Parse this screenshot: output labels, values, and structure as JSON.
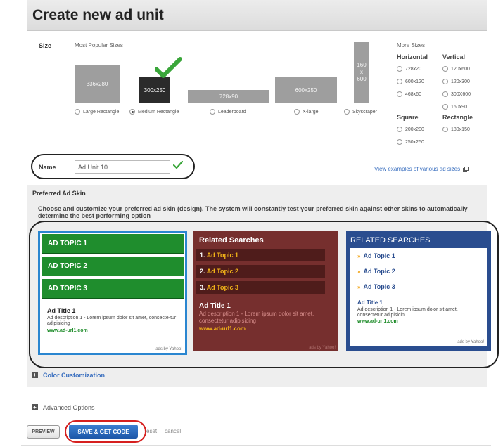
{
  "header": {
    "title": "Create new ad unit"
  },
  "size": {
    "label": "Size",
    "popular_label": "Most Popular Sizes",
    "boxes": [
      {
        "size": "336x280",
        "radio": "Large Rectangle",
        "selected": false
      },
      {
        "size": "300x250",
        "radio": "Medium Rectangle",
        "selected": true
      },
      {
        "size": "728x90",
        "radio": "Leaderboard",
        "selected": false
      },
      {
        "size": "600x250",
        "radio": "X-large",
        "selected": false
      },
      {
        "size_lines": [
          "160",
          "x",
          "600"
        ],
        "radio": "Skyscraper",
        "selected": false
      }
    ],
    "more_sizes": {
      "title": "More Sizes",
      "horizontal": {
        "title": "Horizontal",
        "options": [
          "728x20",
          "600x120",
          "468x60"
        ]
      },
      "vertical": {
        "title": "Vertical",
        "options": [
          "120x600",
          "120x300",
          "300X600",
          "160x90"
        ]
      },
      "square": {
        "title": "Square",
        "options": [
          "200x200",
          "250x250"
        ]
      },
      "rectangle": {
        "title": "Rectangle",
        "options": [
          "180x150"
        ]
      }
    }
  },
  "name_field": {
    "label": "Name",
    "value": "Ad Unit 10",
    "examples_link": "View examples of various ad sizes"
  },
  "preferred_skin": {
    "title": "Preferred Ad Skin",
    "description": "Choose and customize your preferred ad skin (design), The system will constantly test your preferred skin against other skins to automatically determine the best performing option",
    "skin1": {
      "topics": [
        "AD TOPIC 1",
        "AD TOPIC 2",
        "AD TOPIC 3"
      ],
      "ad_title": "Ad Title 1",
      "ad_desc": "Ad description 1 - Lorem ipsum dolor sit amet, consecte-tur adipisicing",
      "ad_url": "www.ad-url1.com",
      "ads_by": "ads by Yahoo!"
    },
    "skin2": {
      "title": "Related Searches",
      "items": [
        {
          "num": "1.",
          "text": "Ad Topic 1"
        },
        {
          "num": "2.",
          "text": "Ad Topic 2"
        },
        {
          "num": "3.",
          "text": "Ad Topic 3"
        }
      ],
      "ad_title": "Ad Title 1",
      "ad_desc": "Ad description 1 - Lorem ipsum dolor sit amet, consectetur adipisicing",
      "ad_url": "www.ad-url1.com",
      "ads_by": "ads by Yahoo!"
    },
    "skin3": {
      "title": "RELATED SEARCHES",
      "items": [
        "Ad Topic 1",
        "Ad Topic 2",
        "Ad Topic 3"
      ],
      "ad_title": "Ad Title 1",
      "ad_desc": "Ad description 1 - Lorem ipsum dolor sit amet, consectetur adipisicin",
      "ad_url": "www.ad-url1.com",
      "ads_by": "ads by Yahoo!"
    }
  },
  "color_customization": {
    "label": "Color Customization"
  },
  "advanced_options": {
    "label": "Advanced Options"
  },
  "actions": {
    "preview": "PREVIEW",
    "save": "SAVE & GET CODE",
    "reset": "eset",
    "cancel": "cancel"
  },
  "colors": {
    "accent_blue": "#3a6fbf",
    "green_skin": "#1f8d2d",
    "maroon_skin": "#762f2e",
    "blue_skin": "#2a4d8f",
    "highlight_gold": "#f2b418",
    "check_green": "#3aa63a",
    "annotation_red": "#d6201f"
  }
}
